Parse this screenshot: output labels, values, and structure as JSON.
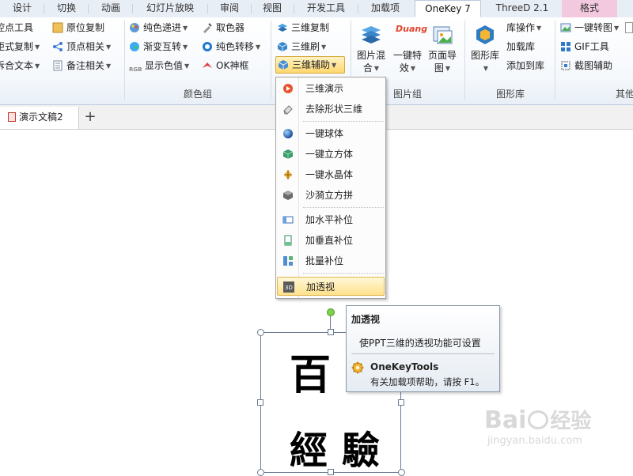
{
  "tabs": [
    {
      "label": "设计"
    },
    {
      "label": "切换"
    },
    {
      "label": "动画"
    },
    {
      "label": "幻灯片放映"
    },
    {
      "label": "审阅"
    },
    {
      "label": "视图"
    },
    {
      "label": "开发工具"
    },
    {
      "label": "加载项"
    },
    {
      "label": "OneKey 7"
    },
    {
      "label": "ThreeD 2.1"
    },
    {
      "label": "格式"
    }
  ],
  "ribbon": {
    "col1": [
      "控点工具",
      "矩式复制",
      "拆合文本"
    ],
    "col2": [
      "原位复制",
      "顶点相关",
      "备注相关"
    ],
    "color_group": {
      "items": [
        "纯色递进",
        "渐变互转",
        "显示色值",
        "取色器",
        "纯色转移",
        "OK神框"
      ],
      "label": "颜色组"
    },
    "threeD": {
      "items": [
        "三维复制",
        "三维刷",
        "三维辅助"
      ]
    },
    "picture_group": {
      "big": [
        "图片混合",
        "一键特效",
        "页面导图"
      ],
      "duang": "Duang",
      "label": "图片组"
    },
    "shape_lib": {
      "big": "图形库",
      "items": [
        "库操作",
        "加载库",
        "添加到库"
      ],
      "label": "图形库"
    },
    "other": {
      "items": [
        "一键转图",
        "GIF工具",
        "截图辅助"
      ],
      "label": "其他"
    }
  },
  "document": {
    "tab_label": "演示文稿2",
    "add_symbol": "+"
  },
  "menu": {
    "items": [
      {
        "label": "三维演示",
        "icon": "presentation-icon"
      },
      {
        "label": "去除形状三维",
        "icon": "eraser-icon"
      },
      {
        "label": "一键球体",
        "icon": "sphere-icon"
      },
      {
        "label": "一键立方体",
        "icon": "cube-icon"
      },
      {
        "label": "一键水晶体",
        "icon": "crystal-icon"
      },
      {
        "label": "沙漪立方拼",
        "icon": "cube-tile-icon"
      },
      {
        "label": "加水平补位",
        "icon": "horizontal-pad-icon"
      },
      {
        "label": "加垂直补位",
        "icon": "vertical-pad-icon"
      },
      {
        "label": "批量补位",
        "icon": "batch-pad-icon"
      },
      {
        "label": "加透视",
        "icon": "perspective-3d-icon"
      }
    ]
  },
  "tooltip": {
    "title": "加透视",
    "description": "使PPT三维的透视功能可设置",
    "addin": "OneKeyTools",
    "help": "有关加载项帮助，请按 F1。"
  },
  "slide": {
    "glyphs": [
      "百",
      "經",
      "驗"
    ]
  },
  "watermark": {
    "brand": "Bai",
    "brand2": "经验",
    "url": "jingyan.baidu.com"
  },
  "colors": {
    "tab_active_bg": "#ffffff",
    "format_tab_bg": "#f2c9de",
    "highlight": "#ffd76e",
    "rotation_handle": "#7fd14b"
  }
}
